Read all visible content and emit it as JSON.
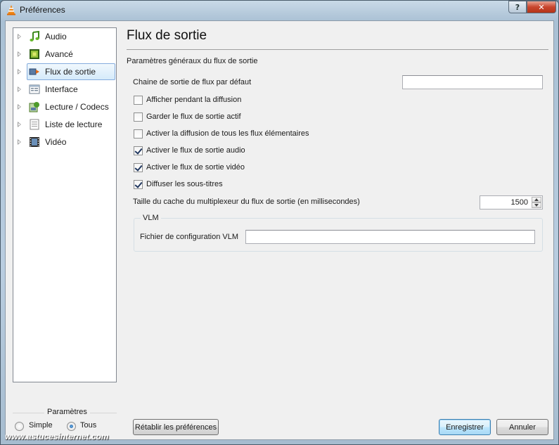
{
  "window": {
    "title": "Préférences",
    "help": "?",
    "close": "✕"
  },
  "sidebar": {
    "items": [
      {
        "label": "Audio",
        "icon": "music-note-icon"
      },
      {
        "label": "Avancé",
        "icon": "chip-icon"
      },
      {
        "label": "Flux de sortie",
        "icon": "stream-output-icon",
        "selected": true
      },
      {
        "label": "Interface",
        "icon": "interface-icon"
      },
      {
        "label": "Lecture / Codecs",
        "icon": "codecs-icon"
      },
      {
        "label": "Liste de lecture",
        "icon": "playlist-icon"
      },
      {
        "label": "Vidéo",
        "icon": "film-icon"
      }
    ]
  },
  "params": {
    "title": "Paramètres",
    "simple": "Simple",
    "all": "Tous",
    "selected": "Tous"
  },
  "main": {
    "title": "Flux de sortie",
    "section": "Paramètres généraux du flux de sortie",
    "default_chain_label": "Chaine de sortie de flux par défaut",
    "default_chain_value": "",
    "checkboxes": [
      {
        "label": "Afficher pendant la diffusion",
        "checked": false
      },
      {
        "label": "Garder le flux de sortie actif",
        "checked": false
      },
      {
        "label": "Activer la diffusion de tous les flux élémentaires",
        "checked": false
      },
      {
        "label": "Activer le flux de sortie audio",
        "checked": true
      },
      {
        "label": "Activer le flux de sortie vidéo",
        "checked": true
      },
      {
        "label": "Diffuser les sous-titres",
        "checked": true
      }
    ],
    "cache_label": "Taille du cache du multiplexeur du flux de sortie (en millisecondes)",
    "cache_value": "1500",
    "vlm_group": "VLM",
    "vlm_label": "Fichier de configuration VLM",
    "vlm_value": ""
  },
  "buttons": {
    "reset": "Rétablir les préférences",
    "save": "Enregistrer",
    "cancel": "Annuler"
  },
  "watermark": "www.astucesinternet.com"
}
